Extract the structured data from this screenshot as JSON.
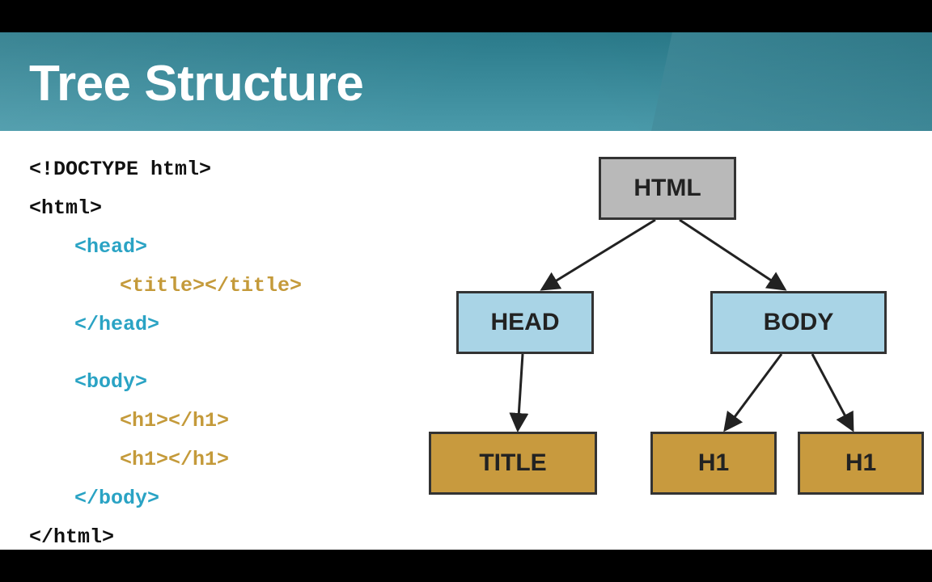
{
  "title": "Tree Structure",
  "code": {
    "doctype": "<!DOCTYPE html>",
    "html_open": "<html>",
    "head_open": "<head>",
    "title_tag": "<title></title>",
    "head_close": "</head>",
    "body_open": "<body>",
    "h1_1": "<h1></h1>",
    "h1_2": "<h1></h1>",
    "body_close": "</body>",
    "html_close": "</html>"
  },
  "diagram": {
    "html": "HTML",
    "head": "HEAD",
    "body": "BODY",
    "title": "TITLE",
    "h1a": "H1",
    "h1b": "H1"
  }
}
